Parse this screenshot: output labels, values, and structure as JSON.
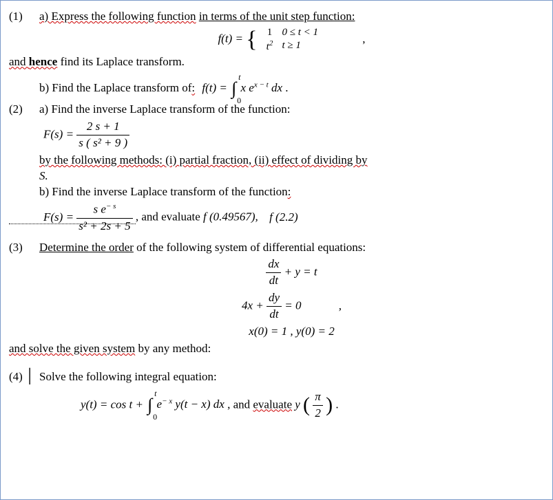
{
  "problems": [
    {
      "number": "(1)",
      "part_a_intro": "a) Express the following function",
      "part_a_rest": "in terms of the unit step function:",
      "ft_eq": "f(t) =",
      "piece1_val": "1",
      "piece1_cond": "0 ≤ t < 1",
      "piece2_val": "t",
      "piece2_sup": "2",
      "piece2_cond": "t ≥ 1",
      "comma1": ",",
      "and_word": "and ",
      "hence_word": "hence",
      "hence_rest": " find its Laplace transform.",
      "part_b": "b) Find the Laplace transform of",
      "part_b_tail": ":",
      "part_b_eq_lhs": "f(t) =",
      "int_upper": "t",
      "int_lower": "0",
      "int_body1": "x e",
      "int_exp": "x − t",
      "int_body2": " dx",
      "int_tail": " ."
    },
    {
      "number": "(2)",
      "part_a": "a) Find the inverse Laplace transform of the function:",
      "Fs_lhs": "F(s) =",
      "num": "2 s + 1",
      "den": "s ( s² + 9 )",
      "by_methods": "by the following methods: (i) partial fraction, (ii) effect of dividing by",
      "s_line": "S.",
      "part_b": "b) Find the inverse Laplace transform of the function",
      "part_b_tail": ":",
      "Fs2_lhs": "F(s) =",
      "num2_a": "s e",
      "num2_exp": "− s",
      "den2": "s² + 2s + 5",
      "eval_text": ", and evaluate  ",
      "eval_f1": "f (0.49567),",
      "eval_f2": "f (2.2)"
    },
    {
      "number": "(3)",
      "intro": "Determine the order",
      "intro_rest": " of the following system of differential equations:",
      "eq1_frac_num": "dx",
      "eq1_frac_den": "dt",
      "eq1_rest": " + y = t",
      "eq2_pre": "4x + ",
      "eq2_frac_num": "dy",
      "eq2_frac_den": "dt",
      "eq2_rest": " = 0",
      "comma2": ",",
      "ic": "x(0) = 1   ,   y(0) = 2",
      "solve_text": "and solve the given system",
      "solve_rest": " by any method:"
    },
    {
      "number": "(4)",
      "intro": "Solve the following integral equation:",
      "yt_eq": "y(t) = cos t + ",
      "int_upper": "t",
      "int_lower": "0",
      "int_body_a": "e",
      "int_exp": "− x",
      "int_body_b": " y(t − x) dx",
      "eval_text": " , and ",
      "eval_word": "evaluate",
      "eval_tail": " ",
      "y_of": "y",
      "frac_num": "π",
      "frac_den": "2",
      "period": "."
    }
  ]
}
